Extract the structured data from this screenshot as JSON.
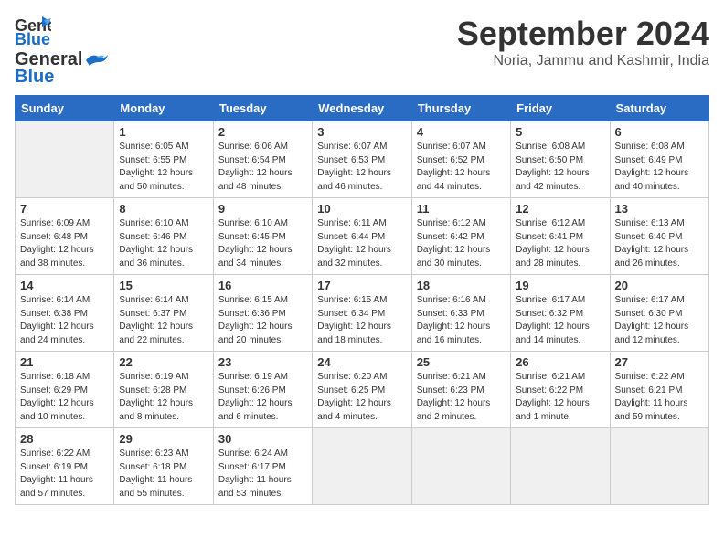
{
  "header": {
    "logo_line1": "General",
    "logo_line2": "Blue",
    "month": "September 2024",
    "location": "Noria, Jammu and Kashmir, India"
  },
  "weekdays": [
    "Sunday",
    "Monday",
    "Tuesday",
    "Wednesday",
    "Thursday",
    "Friday",
    "Saturday"
  ],
  "days": [
    {
      "date": "",
      "sunrise": "",
      "sunset": "",
      "daylight": ""
    },
    {
      "date": "1",
      "sunrise": "6:05 AM",
      "sunset": "6:55 PM",
      "daylight": "12 hours and 50 minutes."
    },
    {
      "date": "2",
      "sunrise": "6:06 AM",
      "sunset": "6:54 PM",
      "daylight": "12 hours and 48 minutes."
    },
    {
      "date": "3",
      "sunrise": "6:07 AM",
      "sunset": "6:53 PM",
      "daylight": "12 hours and 46 minutes."
    },
    {
      "date": "4",
      "sunrise": "6:07 AM",
      "sunset": "6:52 PM",
      "daylight": "12 hours and 44 minutes."
    },
    {
      "date": "5",
      "sunrise": "6:08 AM",
      "sunset": "6:50 PM",
      "daylight": "12 hours and 42 minutes."
    },
    {
      "date": "6",
      "sunrise": "6:08 AM",
      "sunset": "6:49 PM",
      "daylight": "12 hours and 40 minutes."
    },
    {
      "date": "7",
      "sunrise": "6:09 AM",
      "sunset": "6:48 PM",
      "daylight": "12 hours and 38 minutes."
    },
    {
      "date": "8",
      "sunrise": "6:10 AM",
      "sunset": "6:46 PM",
      "daylight": "12 hours and 36 minutes."
    },
    {
      "date": "9",
      "sunrise": "6:10 AM",
      "sunset": "6:45 PM",
      "daylight": "12 hours and 34 minutes."
    },
    {
      "date": "10",
      "sunrise": "6:11 AM",
      "sunset": "6:44 PM",
      "daylight": "12 hours and 32 minutes."
    },
    {
      "date": "11",
      "sunrise": "6:12 AM",
      "sunset": "6:42 PM",
      "daylight": "12 hours and 30 minutes."
    },
    {
      "date": "12",
      "sunrise": "6:12 AM",
      "sunset": "6:41 PM",
      "daylight": "12 hours and 28 minutes."
    },
    {
      "date": "13",
      "sunrise": "6:13 AM",
      "sunset": "6:40 PM",
      "daylight": "12 hours and 26 minutes."
    },
    {
      "date": "14",
      "sunrise": "6:14 AM",
      "sunset": "6:38 PM",
      "daylight": "12 hours and 24 minutes."
    },
    {
      "date": "15",
      "sunrise": "6:14 AM",
      "sunset": "6:37 PM",
      "daylight": "12 hours and 22 minutes."
    },
    {
      "date": "16",
      "sunrise": "6:15 AM",
      "sunset": "6:36 PM",
      "daylight": "12 hours and 20 minutes."
    },
    {
      "date": "17",
      "sunrise": "6:15 AM",
      "sunset": "6:34 PM",
      "daylight": "12 hours and 18 minutes."
    },
    {
      "date": "18",
      "sunrise": "6:16 AM",
      "sunset": "6:33 PM",
      "daylight": "12 hours and 16 minutes."
    },
    {
      "date": "19",
      "sunrise": "6:17 AM",
      "sunset": "6:32 PM",
      "daylight": "12 hours and 14 minutes."
    },
    {
      "date": "20",
      "sunrise": "6:17 AM",
      "sunset": "6:30 PM",
      "daylight": "12 hours and 12 minutes."
    },
    {
      "date": "21",
      "sunrise": "6:18 AM",
      "sunset": "6:29 PM",
      "daylight": "12 hours and 10 minutes."
    },
    {
      "date": "22",
      "sunrise": "6:19 AM",
      "sunset": "6:28 PM",
      "daylight": "12 hours and 8 minutes."
    },
    {
      "date": "23",
      "sunrise": "6:19 AM",
      "sunset": "6:26 PM",
      "daylight": "12 hours and 6 minutes."
    },
    {
      "date": "24",
      "sunrise": "6:20 AM",
      "sunset": "6:25 PM",
      "daylight": "12 hours and 4 minutes."
    },
    {
      "date": "25",
      "sunrise": "6:21 AM",
      "sunset": "6:23 PM",
      "daylight": "12 hours and 2 minutes."
    },
    {
      "date": "26",
      "sunrise": "6:21 AM",
      "sunset": "6:22 PM",
      "daylight": "12 hours and 1 minute."
    },
    {
      "date": "27",
      "sunrise": "6:22 AM",
      "sunset": "6:21 PM",
      "daylight": "11 hours and 59 minutes."
    },
    {
      "date": "28",
      "sunrise": "6:22 AM",
      "sunset": "6:19 PM",
      "daylight": "11 hours and 57 minutes."
    },
    {
      "date": "29",
      "sunrise": "6:23 AM",
      "sunset": "6:18 PM",
      "daylight": "11 hours and 55 minutes."
    },
    {
      "date": "30",
      "sunrise": "6:24 AM",
      "sunset": "6:17 PM",
      "daylight": "11 hours and 53 minutes."
    }
  ]
}
